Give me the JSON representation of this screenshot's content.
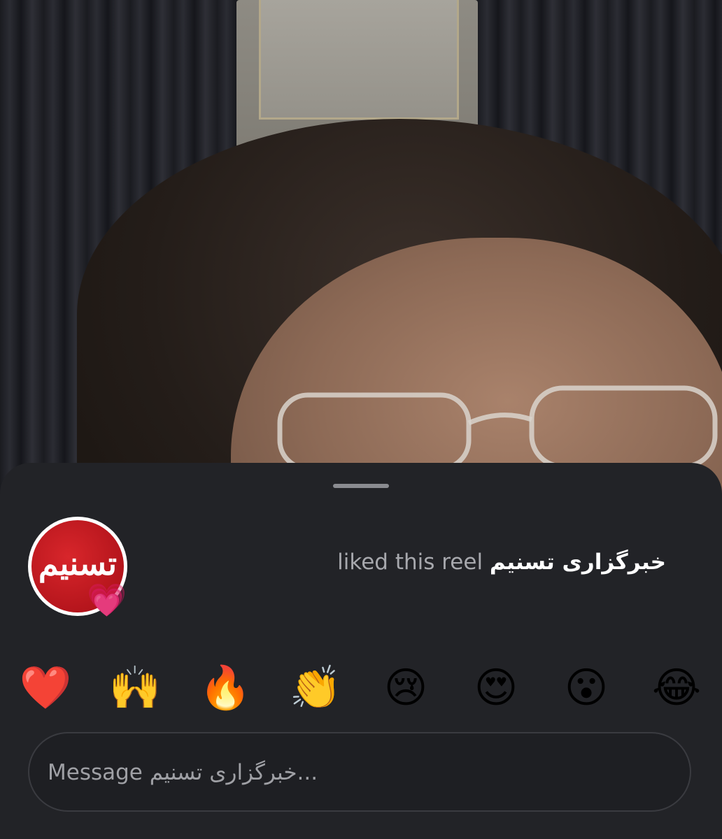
{
  "reel": {
    "description_icon": "reel-video"
  },
  "sheet": {
    "account_name": "خبرگزاری تسنیم",
    "liked_text": "liked this reel",
    "avatar_logo_text": "تسنیم",
    "avatar_badge": "💗",
    "reactions": [
      {
        "name": "red-heart",
        "emoji": "❤️"
      },
      {
        "name": "raising-hands",
        "emoji": "🙌"
      },
      {
        "name": "fire",
        "emoji": "🔥"
      },
      {
        "name": "clapping-hands",
        "emoji": "👏"
      },
      {
        "name": "crying-face",
        "emoji": "😢"
      },
      {
        "name": "heart-eyes",
        "emoji": "😍"
      },
      {
        "name": "surprised-face",
        "emoji": "😮"
      },
      {
        "name": "tears-of-joy",
        "emoji": "😂"
      }
    ],
    "message_placeholder": "Message خبرگزاری تسنیم..."
  },
  "colors": {
    "sheet_bg": "#222327",
    "avatar_red": "#c41a20",
    "muted_text": "#a7a8ad"
  }
}
